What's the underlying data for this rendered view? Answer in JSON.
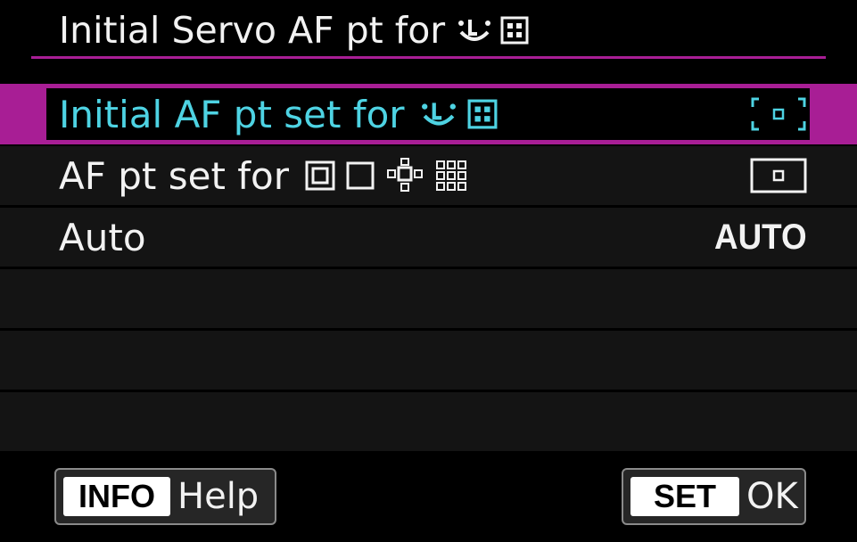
{
  "header": {
    "title": "Initial Servo AF pt for",
    "title_icons": [
      "face-tracking-icon",
      "af-area-icon"
    ]
  },
  "menu": {
    "items": [
      {
        "label": "Initial AF pt set for",
        "label_icons": [
          "face-tracking-icon",
          "af-area-icon"
        ],
        "value_icon": "af-point-bracket-icon",
        "selected": true
      },
      {
        "label": "AF pt set for",
        "label_icons": [
          "spot-af-icon",
          "single-point-af-icon",
          "expand-af-icon",
          "zone-af-icon"
        ],
        "value_icon": "af-point-frame-icon",
        "selected": false
      },
      {
        "label": "Auto",
        "value_text": "AUTO",
        "selected": false
      }
    ]
  },
  "footer": {
    "info_key": "INFO",
    "info_label": "Help",
    "set_key": "SET",
    "set_label": "OK"
  },
  "colors": {
    "accent": "#a81e95",
    "selected_text": "#4ed3e3",
    "background": "#000000",
    "text": "#f2f2f2"
  }
}
